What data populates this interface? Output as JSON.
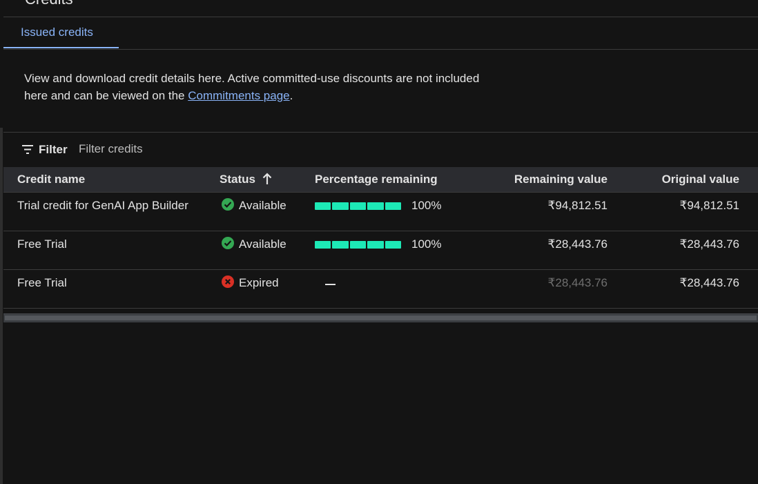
{
  "page": {
    "title": "Credits"
  },
  "tabs": [
    {
      "label": "Issued credits",
      "active": true
    }
  ],
  "description": {
    "text_before": "View and download credit details here. Active committed-use discounts are not included here and can be viewed on the ",
    "link": "Commitments page",
    "text_after": "."
  },
  "filter": {
    "label": "Filter",
    "placeholder": "Filter credits",
    "icon": "filter-list-icon"
  },
  "table": {
    "columns": {
      "name": "Credit name",
      "status": "Status",
      "percentage": "Percentage remaining",
      "remaining": "Remaining value",
      "original": "Original value"
    },
    "sort_icon": "arrow-up-icon",
    "rows": [
      {
        "name": "Trial credit for GenAI App Builder",
        "status": "Available",
        "status_icon": "check-circle-icon",
        "percentage": "100%",
        "percent_fill": 1.0,
        "remaining": "₹94,812.51",
        "original": "₹94,812.51"
      },
      {
        "name": "Free Trial",
        "status": "Available",
        "status_icon": "check-circle-icon",
        "percentage": "100%",
        "percent_fill": 1.0,
        "remaining": "₹28,443.76",
        "original": "₹28,443.76"
      },
      {
        "name": "Free Trial",
        "status": "Expired",
        "status_icon": "error-circle-icon",
        "percentage": "—",
        "remaining": "₹28,443.76",
        "original": "₹28,443.76"
      }
    ]
  },
  "colors": {
    "accent": "#8ab4f8",
    "available": "#34a853",
    "expired": "#d93025",
    "bar": "#1de9b6",
    "background": "#141414"
  }
}
